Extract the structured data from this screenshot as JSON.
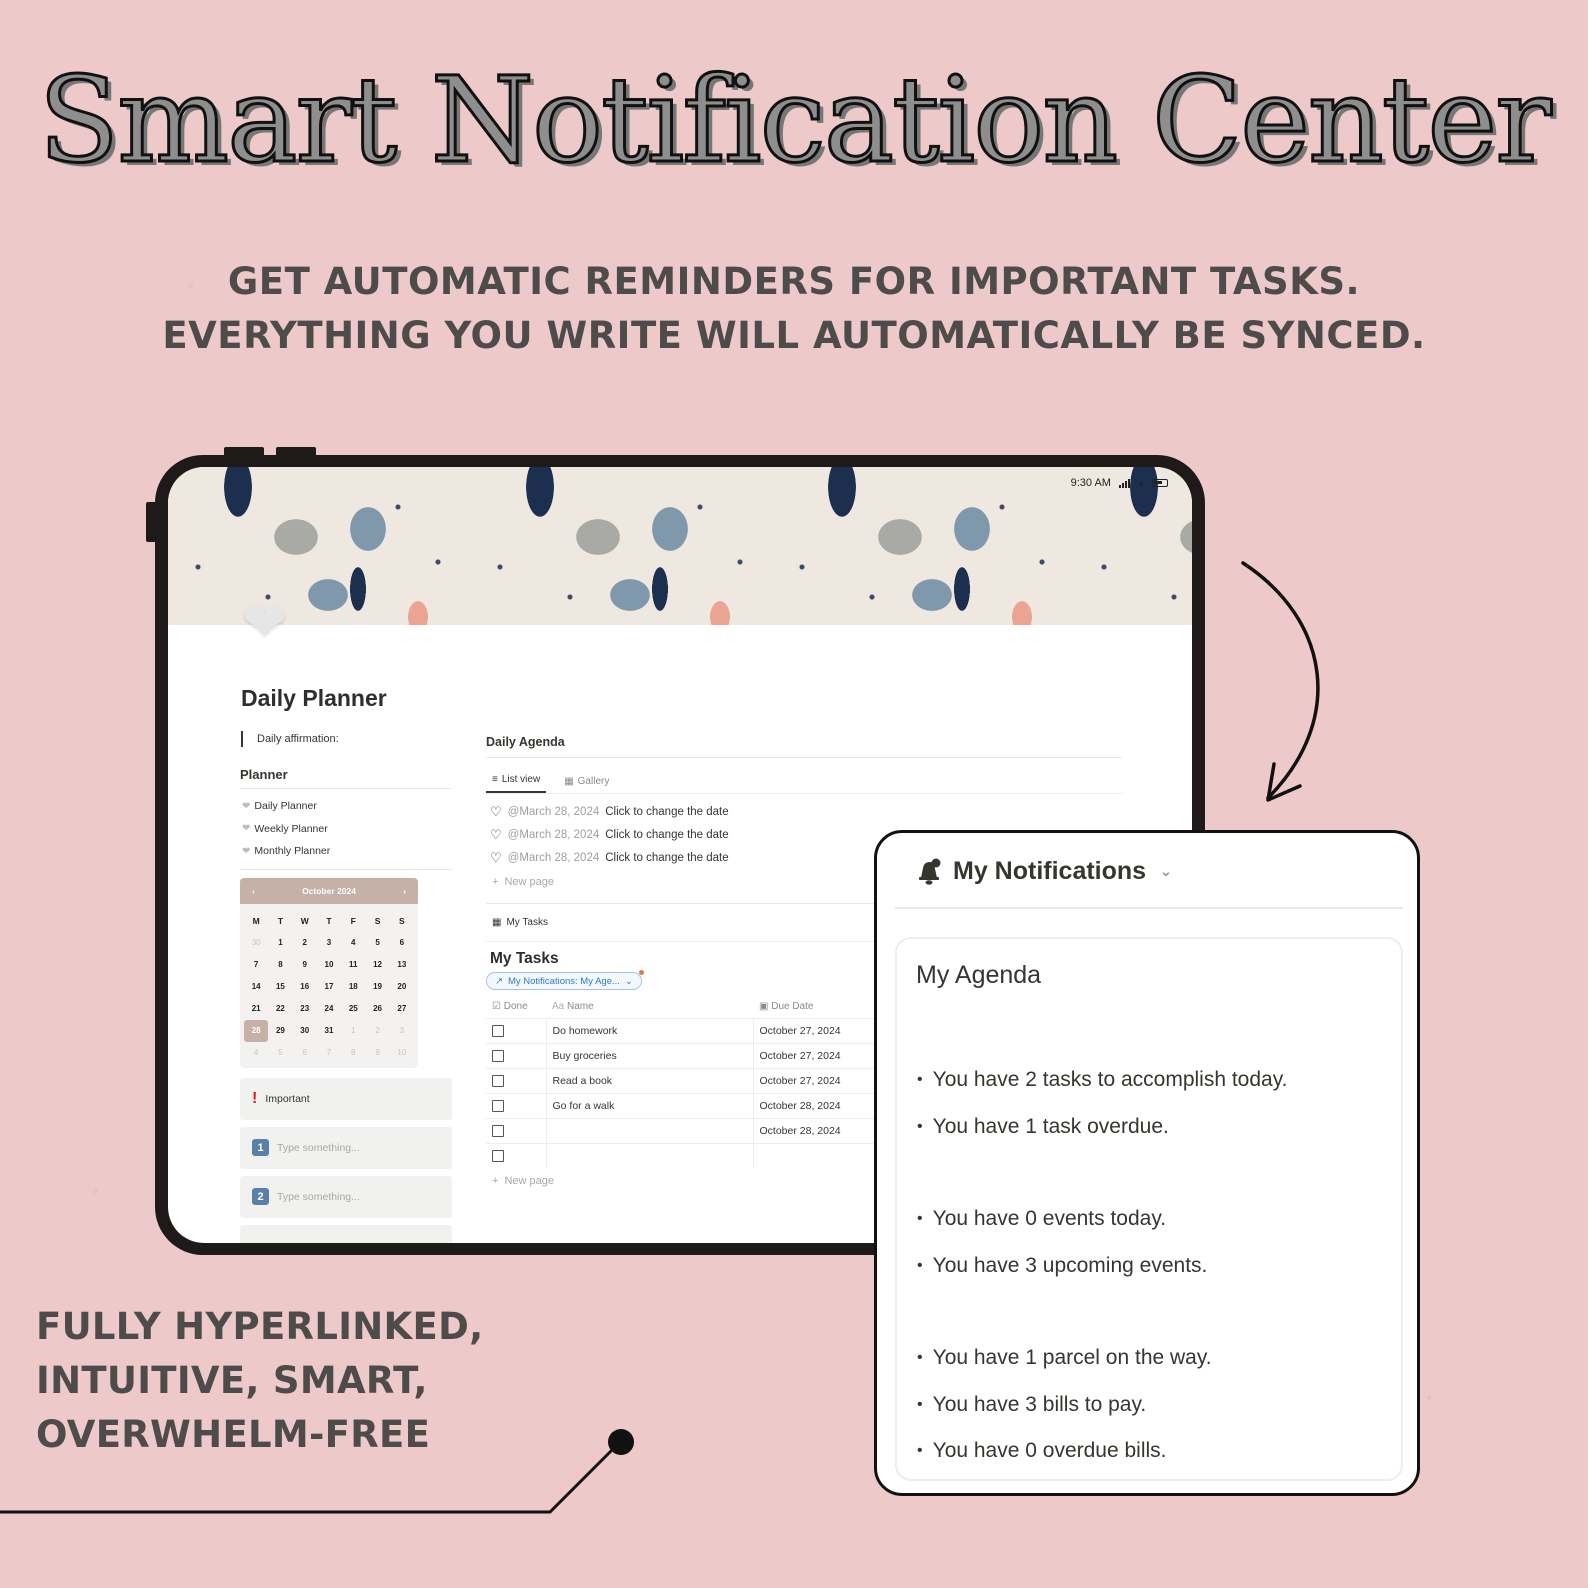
{
  "headline": "Smart Notification Center",
  "subheadline": {
    "line1": "GET AUTOMATIC REMINDERS FOR IMPORTANT TASKS.",
    "line2": "EVERYTHING YOU WRITE WILL AUTOMATICALLY BE SYNCED."
  },
  "features": [
    "FULLY HYPERLINKED,",
    "INTUITIVE, SMART,",
    "OVERWHELM-FREE"
  ],
  "colors": {
    "background": "#edc9c9",
    "text_dark": "#4e4b4b",
    "calendar_accent": "#c5b1a7",
    "link_blue": "#2f7ad1",
    "important_red": "#d21f1f"
  },
  "tablet": {
    "status_bar": {
      "time": "9:30 AM",
      "icons": [
        "signal-icon",
        "wifi-icon",
        "battery-icon"
      ]
    },
    "page_icon": "heart-icon",
    "page_title": "Daily Planner",
    "affirmation_label": "Daily affirmation:",
    "planner": {
      "heading": "Planner",
      "links": [
        {
          "label": "Daily Planner",
          "icon": "heart-link-icon"
        },
        {
          "label": "Weekly Planner",
          "icon": "heart-link-icon"
        },
        {
          "label": "Monthly Planner",
          "icon": "heart-link-icon"
        }
      ]
    },
    "calendar": {
      "month_label": "October 2024",
      "prev": "‹",
      "next": "›",
      "weekdays": [
        "M",
        "T",
        "W",
        "T",
        "F",
        "S",
        "S"
      ],
      "weeks": [
        [
          {
            "d": "30",
            "muted": true
          },
          {
            "d": "1"
          },
          {
            "d": "2"
          },
          {
            "d": "3"
          },
          {
            "d": "4"
          },
          {
            "d": "5"
          },
          {
            "d": "6"
          }
        ],
        [
          {
            "d": "7"
          },
          {
            "d": "8"
          },
          {
            "d": "9"
          },
          {
            "d": "10"
          },
          {
            "d": "11"
          },
          {
            "d": "12"
          },
          {
            "d": "13"
          }
        ],
        [
          {
            "d": "14"
          },
          {
            "d": "15"
          },
          {
            "d": "16"
          },
          {
            "d": "17"
          },
          {
            "d": "18"
          },
          {
            "d": "19"
          },
          {
            "d": "20"
          }
        ],
        [
          {
            "d": "21"
          },
          {
            "d": "22"
          },
          {
            "d": "23"
          },
          {
            "d": "24"
          },
          {
            "d": "25"
          },
          {
            "d": "26"
          },
          {
            "d": "27"
          }
        ],
        [
          {
            "d": "28",
            "today": true
          },
          {
            "d": "29"
          },
          {
            "d": "30"
          },
          {
            "d": "31"
          },
          {
            "d": "1",
            "muted": true
          },
          {
            "d": "2",
            "muted": true
          },
          {
            "d": "3",
            "muted": true
          }
        ],
        [
          {
            "d": "4",
            "muted": true
          },
          {
            "d": "5",
            "muted": true
          },
          {
            "d": "6",
            "muted": true
          },
          {
            "d": "7",
            "muted": true
          },
          {
            "d": "8",
            "muted": true
          },
          {
            "d": "9",
            "muted": true
          },
          {
            "d": "10",
            "muted": true
          }
        ]
      ]
    },
    "callouts": [
      {
        "icon": "!",
        "text": "Important",
        "placeholder": false
      },
      {
        "icon": "1",
        "text": "Type something...",
        "placeholder": true
      },
      {
        "icon": "2",
        "text": "Type something...",
        "placeholder": true
      }
    ],
    "daily_agenda": {
      "title": "Daily Agenda",
      "views": [
        {
          "label": "List view",
          "icon": "list-icon",
          "active": true
        },
        {
          "label": "Gallery",
          "icon": "gallery-icon",
          "active": false
        }
      ],
      "items": [
        {
          "date": "@March 28, 2024",
          "text": "Click to change the date"
        },
        {
          "date": "@March 28, 2024",
          "text": "Click to change the date"
        },
        {
          "date": "@March 28, 2024",
          "text": "Click to change the date"
        }
      ],
      "new_page": "New page"
    },
    "my_tasks": {
      "db_label": "My Tasks",
      "title": "My Tasks",
      "filter": "My Notifications: My Age...",
      "columns": {
        "done": "Done",
        "name": "Name",
        "due": "Due Date"
      },
      "rows": [
        {
          "done": false,
          "name": "Do homework",
          "due": "October 27, 2024"
        },
        {
          "done": false,
          "name": "Buy groceries",
          "due": "October 27, 2024"
        },
        {
          "done": false,
          "name": "Read a book",
          "due": "October 27, 2024"
        },
        {
          "done": false,
          "name": "Go for a walk",
          "due": "October 28, 2024"
        },
        {
          "done": false,
          "name": "",
          "due": "October 28, 2024"
        },
        {
          "done": false,
          "name": "",
          "due": ""
        }
      ],
      "new_page": "New page"
    }
  },
  "notifications": {
    "title": "My Notifications",
    "card_title": "My Agenda",
    "groups": [
      [
        "You have 2 tasks to accomplish today.",
        "You have 1 task overdue."
      ],
      [
        "You have 0 events today.",
        "You have 3 upcoming events."
      ],
      [
        "You have 1 parcel on the way.",
        "You have 3 bills to pay.",
        "You have 0 overdue bills."
      ]
    ]
  }
}
